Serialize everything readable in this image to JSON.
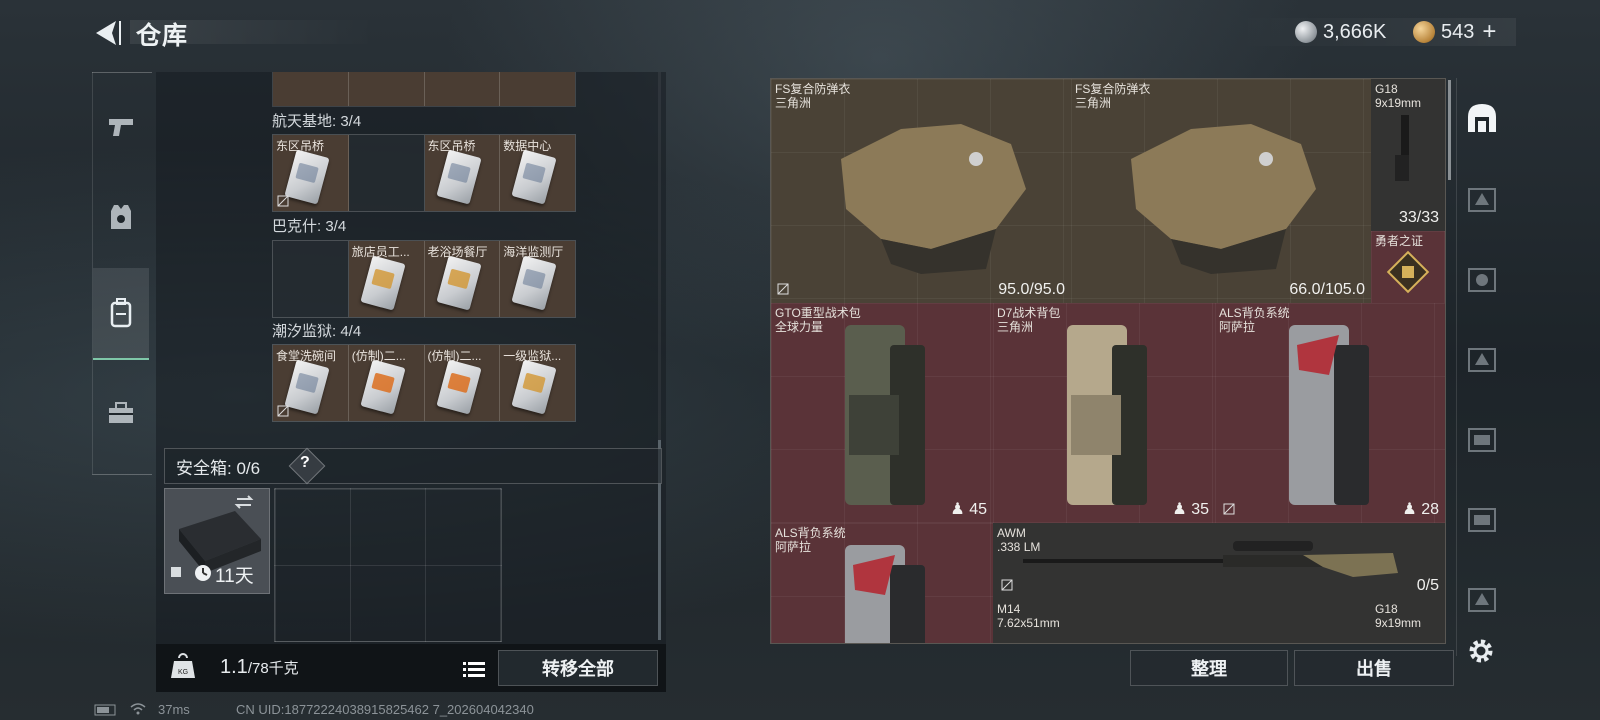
{
  "header": {
    "title": "仓库",
    "currency": [
      {
        "icon": "silver-coin-icon",
        "value": "3,666K"
      },
      {
        "icon": "gold-coin-icon",
        "value": "543"
      }
    ],
    "add_label": "+"
  },
  "left_nav": [
    {
      "icon": "pistol-icon",
      "active": false
    },
    {
      "icon": "armor-vest-icon",
      "active": false
    },
    {
      "icon": "backpack-icon",
      "active": true
    },
    {
      "icon": "toolbox-icon",
      "active": false
    }
  ],
  "storage": {
    "sections": [
      {
        "title": "航天基地: 3/4",
        "cells": [
          "东区吊桥",
          "",
          "东区吊桥",
          "数据中心"
        ]
      },
      {
        "title": "巴克什: 3/4",
        "cells": [
          "",
          "旅店员工...",
          "老浴场餐厅",
          "海洋监测厅"
        ]
      },
      {
        "title": "潮汐监狱: 4/4",
        "cells": [
          "食堂洗碗间",
          "(仿制)二...",
          "(仿制)二...",
          "一级监狱..."
        ]
      }
    ],
    "safe_label": "安全箱: 0/6",
    "safe_help": "?",
    "safe_days": "11天",
    "weight_value": "1.1",
    "weight_max": "/78千克",
    "transfer_all": "转移全部"
  },
  "inventory": {
    "items": [
      {
        "name": "FS复合防弹衣",
        "sub": "三角洲",
        "value": "95.0/95.0"
      },
      {
        "name": "FS复合防弹衣",
        "sub": "三角洲",
        "value": "66.0/105.0"
      },
      {
        "name": "G18",
        "sub": "9x19mm",
        "value": "33/33"
      },
      {
        "name": "勇者之证",
        "sub": "",
        "value": ""
      },
      {
        "name": "GTO重型战术包",
        "sub": "全球力量",
        "value": "45"
      },
      {
        "name": "D7战术背包",
        "sub": "三角洲",
        "value": "35"
      },
      {
        "name": "ALS背负系统",
        "sub": "阿萨拉",
        "value": "28"
      },
      {
        "name": "ALS背负系统",
        "sub": "阿萨拉",
        "value": ""
      },
      {
        "name": "AWM",
        "sub": ".338 LM",
        "value": "0/5"
      },
      {
        "name": "M14",
        "sub": "7.62x51mm",
        "value": ""
      },
      {
        "name": "G18",
        "sub": "9x19mm",
        "value": ""
      }
    ],
    "sort_label": "整理",
    "sell_label": "出售"
  },
  "status_bar": {
    "ping": "37ms",
    "uid": "CN UID:18772224038915825462 7_202604042340"
  }
}
